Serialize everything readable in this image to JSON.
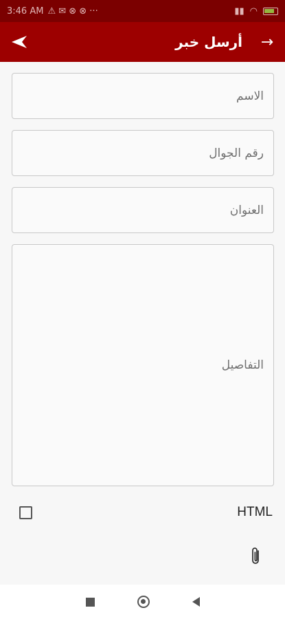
{
  "status_bar": {
    "time": "3:46 AM"
  },
  "app_bar": {
    "title": "أرسل خبر",
    "arrow": "→"
  },
  "form": {
    "name_placeholder": "الاسم",
    "phone_placeholder": "رقم الجوال",
    "address_placeholder": "العنوان",
    "details_placeholder": "التفاصيل"
  },
  "html_option": {
    "label": "HTML",
    "checked": false
  },
  "colors": {
    "app_bar": "#9d0000",
    "status_bar": "#7b0000"
  }
}
